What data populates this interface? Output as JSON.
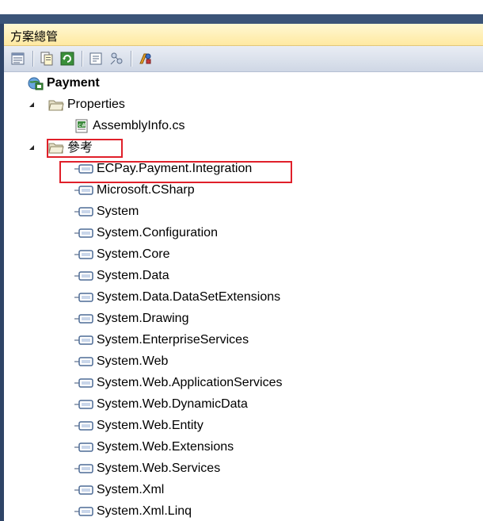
{
  "panel": {
    "title": "方案總管"
  },
  "toolbar": {
    "buttons": [
      {
        "name": "properties-window-icon"
      },
      {
        "name": "show-all-files-icon"
      },
      {
        "name": "refresh-icon"
      },
      {
        "name": "view-code-icon"
      },
      {
        "name": "view-class-diagram-icon"
      },
      {
        "name": "view-designer-icon"
      }
    ]
  },
  "tree": {
    "project": "Payment",
    "properties_folder": "Properties",
    "assembly_info": "AssemblyInfo.cs",
    "references_folder": "參考",
    "references": [
      "ECPay.Payment.Integration",
      "Microsoft.CSharp",
      "System",
      "System.Configuration",
      "System.Core",
      "System.Data",
      "System.Data.DataSetExtensions",
      "System.Drawing",
      "System.EnterpriseServices",
      "System.Web",
      "System.Web.ApplicationServices",
      "System.Web.DynamicData",
      "System.Web.Entity",
      "System.Web.Extensions",
      "System.Web.Services",
      "System.Xml",
      "System.Xml.Linq"
    ]
  },
  "colors": {
    "highlight": "#e0202a",
    "title_bar": "#ffe9a1",
    "toolbar": "#cfd7e5"
  }
}
